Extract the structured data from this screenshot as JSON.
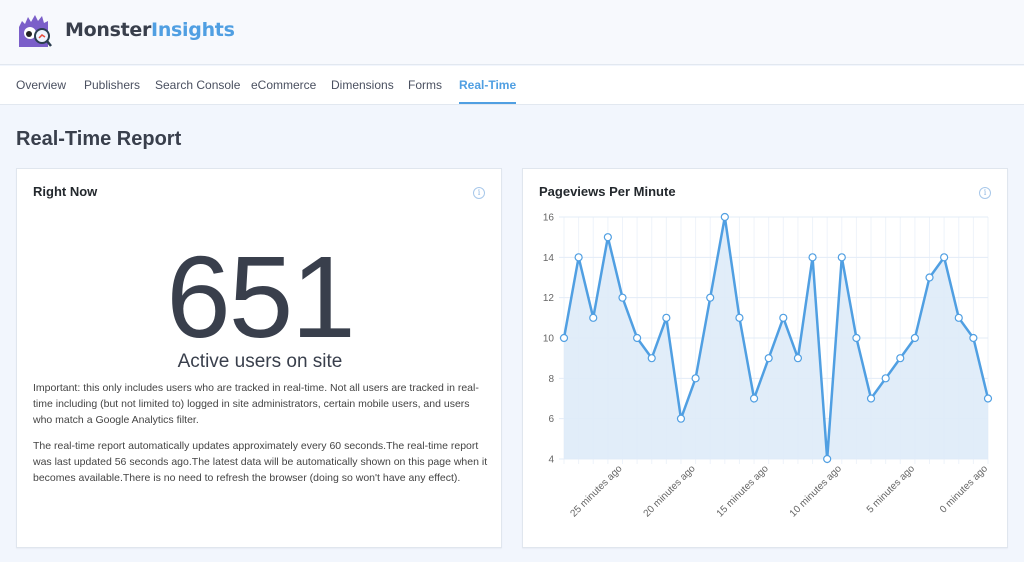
{
  "header": {
    "brand_part1": "Monster",
    "brand_part2": "Insights",
    "logo_icon": "monster-mascot-icon"
  },
  "nav": {
    "tabs": [
      {
        "label": "Overview",
        "active": false
      },
      {
        "label": "Publishers",
        "active": false
      },
      {
        "label": "Search Console",
        "active": false
      },
      {
        "label": "eCommerce",
        "active": false
      },
      {
        "label": "Dimensions",
        "active": false
      },
      {
        "label": "Forms",
        "active": false
      },
      {
        "label": "Real-Time",
        "active": true
      }
    ]
  },
  "page": {
    "title": "Real-Time Report"
  },
  "right_now": {
    "title": "Right Now",
    "info_icon": "info-icon",
    "active_users": "651",
    "active_users_label": "Active users on site",
    "note1": "Important: this only includes users who are tracked in real-time. Not all users are tracked in real-time including (but not limited to) logged in site administrators, certain mobile users, and users who match a Google Analytics filter.",
    "note2": "The real-time report automatically updates approximately every 60 seconds.The real-time report was last updated 56 seconds ago.The latest data will be automatically shown on this page when it becomes available.There is no need to refresh the browser (doing so won't have any effect)."
  },
  "pageviews": {
    "title": "Pageviews Per Minute",
    "info_icon": "info-icon"
  },
  "chart_data": {
    "type": "area",
    "title": "Pageviews Per Minute",
    "xlabel": "",
    "ylabel": "",
    "ylim": [
      4,
      16
    ],
    "yticks": [
      4,
      6,
      8,
      10,
      12,
      14,
      16
    ],
    "grid": true,
    "legend": "none",
    "x_minutes_ago": [
      29,
      28,
      27,
      26,
      25,
      24,
      23,
      22,
      21,
      20,
      19,
      18,
      17,
      16,
      15,
      14,
      13,
      12,
      11,
      10,
      9,
      8,
      7,
      6,
      5,
      4,
      3,
      2,
      1,
      0
    ],
    "x_tick_labels": [
      {
        "minutes_ago": 25,
        "label": "25 minutes ago"
      },
      {
        "minutes_ago": 20,
        "label": "20 minutes ago"
      },
      {
        "minutes_ago": 15,
        "label": "15 minutes ago"
      },
      {
        "minutes_ago": 10,
        "label": "10 minutes ago"
      },
      {
        "minutes_ago": 5,
        "label": "5 minutes ago"
      },
      {
        "minutes_ago": 0,
        "label": "0 minutes ago"
      }
    ],
    "series": [
      {
        "name": "Pageviews",
        "color": "#509fe2",
        "fill": "#deebf8",
        "values": [
          10,
          14,
          11,
          15,
          12,
          10,
          9,
          11,
          6,
          8,
          12,
          16,
          11,
          7,
          9,
          11,
          9,
          14,
          4,
          14,
          10,
          7,
          8,
          9,
          10,
          13,
          14,
          11,
          10,
          7
        ]
      }
    ]
  }
}
